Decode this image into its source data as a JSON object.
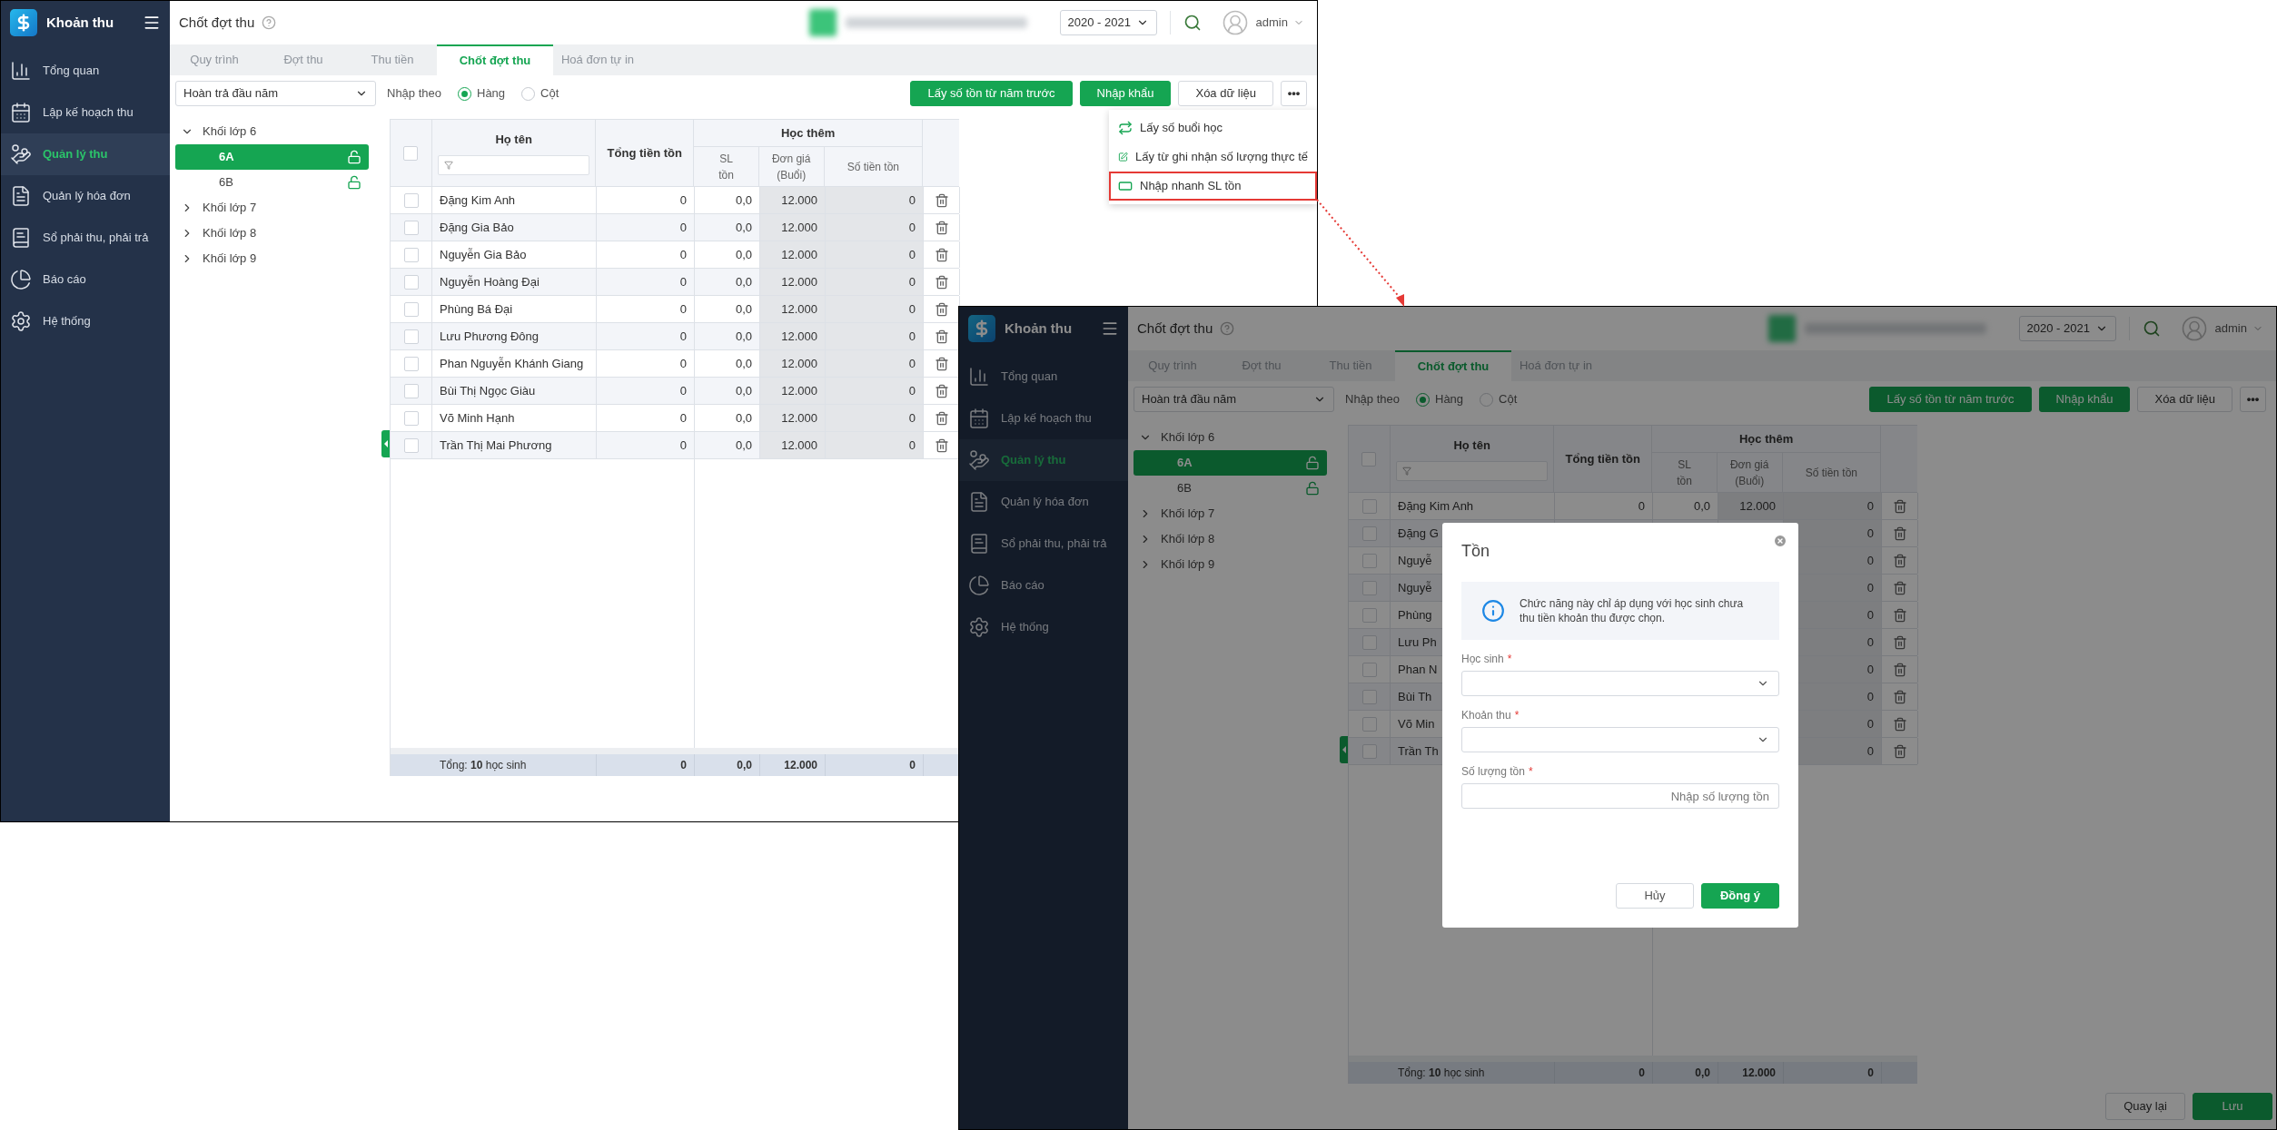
{
  "windows": [
    {
      "app_title": "Khoản thu",
      "page_title": "Chốt đợt thu",
      "year": "2020 - 2021",
      "user": "admin",
      "nav": [
        {
          "label": "Tổng quan",
          "selected": false
        },
        {
          "label": "Lập kế hoạch thu",
          "selected": false
        },
        {
          "label": "Quản lý thu",
          "selected": true
        },
        {
          "label": "Quản lý hóa đơn",
          "selected": false
        },
        {
          "label": "Sổ phải thu, phải trả",
          "selected": false
        },
        {
          "label": "Báo cáo",
          "selected": false
        },
        {
          "label": "Hệ thống",
          "selected": false
        }
      ],
      "tabs": [
        {
          "label": "Quy trình",
          "selected": false
        },
        {
          "label": "Đợt thu",
          "selected": false
        },
        {
          "label": "Thu tiền",
          "selected": false
        },
        {
          "label": "Chốt đợt thu",
          "selected": true
        },
        {
          "label": "Hoá đơn tự in",
          "selected": false
        }
      ],
      "payment_select": "Hoàn trả đầu năm",
      "input_by_label": "Nhập theo",
      "input_by": [
        {
          "label": "Hàng",
          "selected": true
        },
        {
          "label": "Cột",
          "selected": false
        }
      ],
      "actions": [
        {
          "label": "Lấy số tồn từ năm trước",
          "kind": "primary"
        },
        {
          "label": "Nhập khẩu",
          "kind": "primary"
        },
        {
          "label": "Xóa dữ liệu",
          "kind": "secondary"
        },
        {
          "label": "•••",
          "kind": "more"
        }
      ],
      "menu": [
        {
          "label": "Lấy số buổi học",
          "highlighted": false
        },
        {
          "label": "Lấy từ ghi nhận số lượng thực tế",
          "highlighted": false
        },
        {
          "label": "Nhập nhanh SL tồn",
          "highlighted": true
        }
      ],
      "tree": [
        {
          "label": "Khối lớp 6",
          "expanded": true,
          "children": [
            {
              "label": "6A",
              "selected": true
            },
            {
              "label": "6B",
              "selected": false
            }
          ]
        },
        {
          "label": "Khối lớp 7",
          "expanded": false
        },
        {
          "label": "Khối lớp 8",
          "expanded": false
        },
        {
          "label": "Khối lớp 9",
          "expanded": false
        }
      ],
      "table": {
        "all_checked": false,
        "columns": {
          "name": "Họ tên",
          "total": "Tổng tiền tồn",
          "group": "Học thêm",
          "qty": "SL tồn",
          "price": "Đơn giá (Buổi)",
          "amount": "Số tiền tồn"
        },
        "rows": [
          {
            "checked": false,
            "name": "Đặng Kim Anh",
            "total": "0",
            "qty": "0,0",
            "price": "12.000",
            "amount": "0"
          },
          {
            "checked": false,
            "name": "Đặng Gia Bảo",
            "total": "0",
            "qty": "0,0",
            "price": "12.000",
            "amount": "0"
          },
          {
            "checked": false,
            "name": "Nguyễn Gia Bảo",
            "total": "0",
            "qty": "0,0",
            "price": "12.000",
            "amount": "0"
          },
          {
            "checked": false,
            "name": "Nguyễn Hoàng Đại",
            "total": "0",
            "qty": "0,0",
            "price": "12.000",
            "amount": "0"
          },
          {
            "checked": false,
            "name": "Phùng Bá Đại",
            "total": "0",
            "qty": "0,0",
            "price": "12.000",
            "amount": "0"
          },
          {
            "checked": false,
            "name": "Lưu Phương Đông",
            "total": "0",
            "qty": "0,0",
            "price": "12.000",
            "amount": "0"
          },
          {
            "checked": false,
            "name": "Phan Nguyễn Khánh Giang",
            "total": "0",
            "qty": "0,0",
            "price": "12.000",
            "amount": "0"
          },
          {
            "checked": false,
            "name": "Bùi Thị Ngọc Giàu",
            "total": "0",
            "qty": "0,0",
            "price": "12.000",
            "amount": "0"
          },
          {
            "checked": false,
            "name": "Võ Minh Hạnh",
            "total": "0",
            "qty": "0,0",
            "price": "12.000",
            "amount": "0"
          },
          {
            "checked": false,
            "name": "Trần Thị Mai Phương",
            "total": "0",
            "qty": "0,0",
            "price": "12.000",
            "amount": "0"
          }
        ],
        "summary": {
          "label": "Tổng: **10** học sinh",
          "total": "0",
          "qty": "0,0",
          "price": "12.000",
          "amount": "0"
        }
      }
    },
    {
      "app_title": "Khoản thu",
      "page_title": "Chốt đợt thu",
      "year": "2020 - 2021",
      "user": "admin",
      "nav": [
        {
          "label": "Tổng quan",
          "selected": false
        },
        {
          "label": "Lập kế hoạch thu",
          "selected": false
        },
        {
          "label": "Quản lý thu",
          "selected": true
        },
        {
          "label": "Quản lý hóa đơn",
          "selected": false
        },
        {
          "label": "Sổ phải thu, phải trả",
          "selected": false
        },
        {
          "label": "Báo cáo",
          "selected": false
        },
        {
          "label": "Hệ thống",
          "selected": false
        }
      ],
      "tabs": [
        {
          "label": "Quy trình",
          "selected": false
        },
        {
          "label": "Đợt thu",
          "selected": false
        },
        {
          "label": "Thu tiền",
          "selected": false
        },
        {
          "label": "Chốt đợt thu",
          "selected": true
        },
        {
          "label": "Hoá đơn tự in",
          "selected": false
        }
      ],
      "payment_select": "Hoàn trả đầu năm",
      "input_by_label": "Nhập theo",
      "input_by": [
        {
          "label": "Hàng",
          "selected": true
        },
        {
          "label": "Cột",
          "selected": false
        }
      ],
      "actions": [
        {
          "label": "Lấy số tồn từ năm trước",
          "kind": "primary"
        },
        {
          "label": "Nhập khẩu",
          "kind": "primary"
        },
        {
          "label": "Xóa dữ liệu",
          "kind": "secondary"
        },
        {
          "label": "•••",
          "kind": "more"
        }
      ],
      "tree": [
        {
          "label": "Khối lớp 6",
          "expanded": true,
          "children": [
            {
              "label": "6A",
              "selected": true
            },
            {
              "label": "6B",
              "selected": false
            }
          ]
        },
        {
          "label": "Khối lớp 7",
          "expanded": false
        },
        {
          "label": "Khối lớp 8",
          "expanded": false
        },
        {
          "label": "Khối lớp 9",
          "expanded": false
        }
      ],
      "table": {
        "all_checked": false,
        "columns": {
          "name": "Họ tên",
          "total": "Tổng tiền tồn",
          "group": "Học thêm",
          "qty": "SL tồn",
          "price": "Đơn giá (Buổi)",
          "amount": "Số tiền tồn"
        },
        "rows": [
          {
            "checked": false,
            "name": "Đặng Kim Anh",
            "total": "0",
            "qty": "0,0",
            "price": "12.000",
            "amount": "0"
          },
          {
            "checked": false,
            "name": "Đặng G",
            "amount": "0"
          },
          {
            "checked": false,
            "name": "Nguyễ",
            "amount": "0"
          },
          {
            "checked": false,
            "name": "Nguyễ",
            "amount": "0"
          },
          {
            "checked": false,
            "name": "Phùng",
            "amount": "0"
          },
          {
            "checked": false,
            "name": "Lưu Ph",
            "amount": "0"
          },
          {
            "checked": false,
            "name": "Phan N",
            "amount": "0"
          },
          {
            "checked": false,
            "name": "Bùi Th",
            "amount": "0"
          },
          {
            "checked": false,
            "name": "Võ Min",
            "amount": "0"
          },
          {
            "checked": false,
            "name": "Trần Th",
            "amount": "0"
          }
        ],
        "summary": {
          "label": "Tổng: **10** học sinh",
          "total": "0",
          "qty": "0,0",
          "price": "12.000",
          "amount": "0"
        }
      },
      "footer_buttons": [
        {
          "label": "Quay lại",
          "kind": "secondary"
        },
        {
          "label": "Lưu",
          "kind": "primary"
        }
      ],
      "modal": {
        "title": "Tồn",
        "info": "Chức năng này chỉ áp dụng với học sinh chưa thu tiền khoản thu được chọn.",
        "fields": [
          {
            "kind": "select",
            "label": "Học sinh",
            "mark": "*"
          },
          {
            "kind": "select",
            "label": "Khoản thu",
            "mark": "*"
          },
          {
            "kind": "input",
            "label": "Số lượng tồn",
            "mark": "*",
            "placeholder": "Nhập số lượng tồn"
          }
        ],
        "buttons": [
          {
            "label": "Hủy",
            "kind": "secondary"
          },
          {
            "label": "Đồng ý",
            "kind": "primary"
          }
        ]
      }
    }
  ]
}
